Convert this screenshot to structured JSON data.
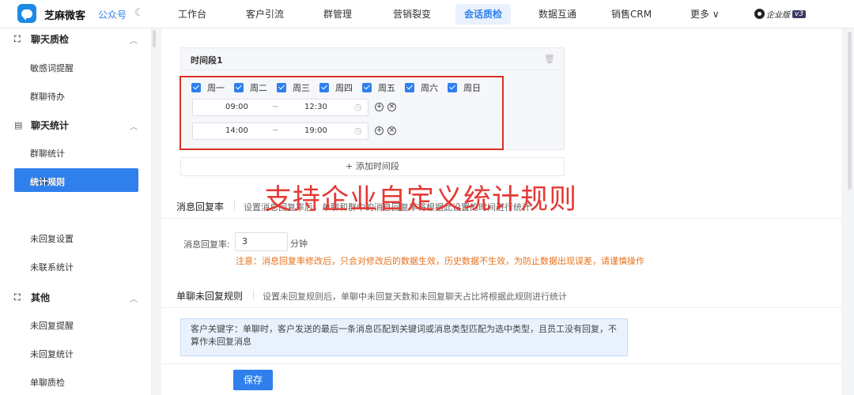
{
  "app": {
    "brand": "芝麻微客",
    "account": "公众号",
    "edition_label": "企业版",
    "edition_version": "v3"
  },
  "topnav": {
    "items": [
      "工作台",
      "客户引流",
      "群管理",
      "营销裂变",
      "会话质检",
      "数据互通",
      "销售CRM",
      "更多 ∨"
    ],
    "active": "会话质检"
  },
  "sidebar": {
    "groups": [
      {
        "label": "聊天质检",
        "items": [
          "敏感词提醒",
          "群聊待办"
        ]
      },
      {
        "label": "聊天统计",
        "items": [
          "群聊统计",
          "单聊统计",
          "统计规则",
          "未回复设置",
          "未联系统计"
        ]
      },
      {
        "label": "其他",
        "items": [
          "未回复提醒",
          "未回复统计",
          "单聊质检"
        ]
      }
    ],
    "active": "统计规则"
  },
  "period": {
    "title": "时间段1",
    "days": [
      "周一",
      "周二",
      "周三",
      "周四",
      "周五",
      "周六",
      "周日"
    ],
    "ranges": [
      {
        "start": "09:00",
        "sep": "~",
        "end": "12:30"
      },
      {
        "start": "14:00",
        "sep": "~",
        "end": "19:00"
      }
    ],
    "add_label": "+ 添加时间段"
  },
  "overlay": {
    "text": "支持企业自定义统计规则",
    "color": "#e53935"
  },
  "reply_rate": {
    "title": "消息回复率",
    "desc": "设置消息回复率后，单聊和群中的消息回复率将根据此设置的时间进行统计",
    "field_label": "消息回复率:",
    "value": "3",
    "unit": "分钟",
    "warning": "注意：消息回复率修改后，只会对修改后的数据生效，历史数据不生效，为防止数据出现误差，请谨慎操作"
  },
  "no_reply": {
    "title": "单聊未回复规则",
    "desc": "设置未回复规则后，单聊中未回复天数和未回复聊天占比将根据此规则进行统计",
    "info": "客户关键字：单聊时，客户发送的最后一条消息匹配到关键词或消息类型匹配为选中类型，且员工没有回复，不算作未回复消息"
  },
  "footer": {
    "save_label": "保存"
  },
  "colors": {
    "accent": "#2f80ed",
    "warning": "#e6711b",
    "highlight_box": "#d93025"
  }
}
